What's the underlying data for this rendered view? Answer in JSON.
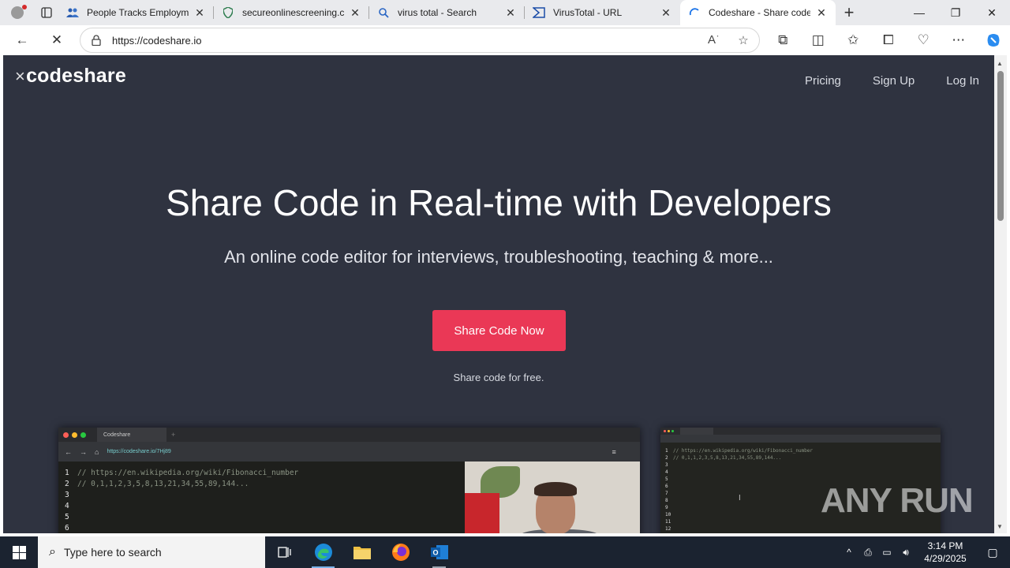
{
  "browser": {
    "tabs": [
      {
        "title": "People Tracks Employme",
        "icon": "people-icon"
      },
      {
        "title": "secureonlinescreening.co",
        "icon": "shield-icon"
      },
      {
        "title": "virus total - Search",
        "icon": "search-icon"
      },
      {
        "title": "VirusTotal - URL",
        "icon": "virustotal-icon"
      },
      {
        "title": "Codeshare - Share code",
        "icon": "loading-icon"
      }
    ],
    "active_tab": 4,
    "url": "https://codeshare.io"
  },
  "page": {
    "logo": "codeshare",
    "nav": [
      "Pricing",
      "Sign Up",
      "Log In"
    ],
    "hero_title": "Share Code in Real-time with Developers",
    "hero_subtitle": "An online code editor for interviews, troubleshooting, teaching & more...",
    "cta_label": "Share Code Now",
    "cta_note": "Share code for free.",
    "cta_color": "#ea3856",
    "background_color": "#2f3340"
  },
  "screenshot_main": {
    "tab_label": "Codeshare",
    "url": "https://codeshare.io/7Hj89",
    "lines": [
      {
        "n": "1",
        "text": "// https://en.wikipedia.org/wiki/Fibonacci_number"
      },
      {
        "n": "2",
        "text": "// 0,1,1,2,3,5,8,13,21,34,55,89,144..."
      },
      {
        "n": "3",
        "text": ""
      },
      {
        "n": "4",
        "text": ""
      },
      {
        "n": "5",
        "text": ""
      },
      {
        "n": "6",
        "text": ""
      }
    ]
  },
  "screenshot_side": {
    "lines": [
      {
        "n": "1",
        "text": "// https://en.wikipedia.org/wiki/Fibonacci_number"
      },
      {
        "n": "2",
        "text": "// 0,1,1,2,3,5,8,13,21,34,55,89,144..."
      },
      {
        "n": "3",
        "text": ""
      },
      {
        "n": "4",
        "text": ""
      },
      {
        "n": "5",
        "text": ""
      },
      {
        "n": "6",
        "text": ""
      },
      {
        "n": "7",
        "text": ""
      },
      {
        "n": "8",
        "text": ""
      },
      {
        "n": "9",
        "text": ""
      },
      {
        "n": "10",
        "text": ""
      },
      {
        "n": "11",
        "text": ""
      },
      {
        "n": "12",
        "text": ""
      }
    ]
  },
  "watermark": "ANY RUN",
  "taskbar": {
    "search_placeholder": "Type here to search",
    "apps": [
      "task-view-icon",
      "edge-icon",
      "file-explorer-icon",
      "firefox-icon",
      "outlook-icon"
    ],
    "time": "3:14 PM",
    "date": "4/29/2025"
  }
}
